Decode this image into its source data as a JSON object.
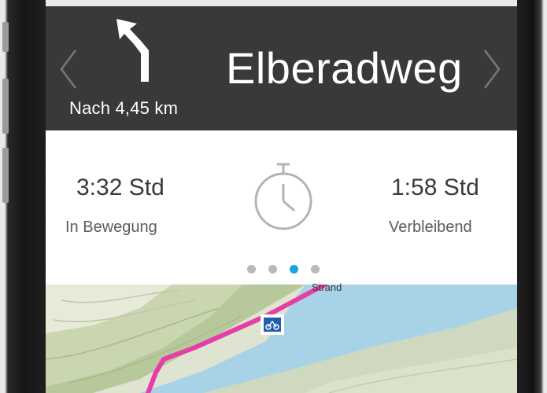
{
  "nav": {
    "street": "Elberadweg",
    "distance": "Nach 4,45 km",
    "turn_icon": "turn-left-arrow",
    "prev_icon": "chevron-left",
    "next_icon": "chevron-right"
  },
  "stats": {
    "left": {
      "value": "3:32 Std",
      "label": "In Bewegung"
    },
    "right": {
      "value": "1:58 Std",
      "label": "Verbleibend"
    },
    "center_icon": "stopwatch",
    "pager": {
      "count": 4,
      "active_index": 2
    }
  },
  "map": {
    "place_label": "Strand",
    "poi_icon": "bicycle-sign",
    "route_color": "#e63ea7",
    "river_color": "#a8d2e6"
  },
  "colors": {
    "header_bg": "#3b3938",
    "accent": "#1aa5dd"
  }
}
